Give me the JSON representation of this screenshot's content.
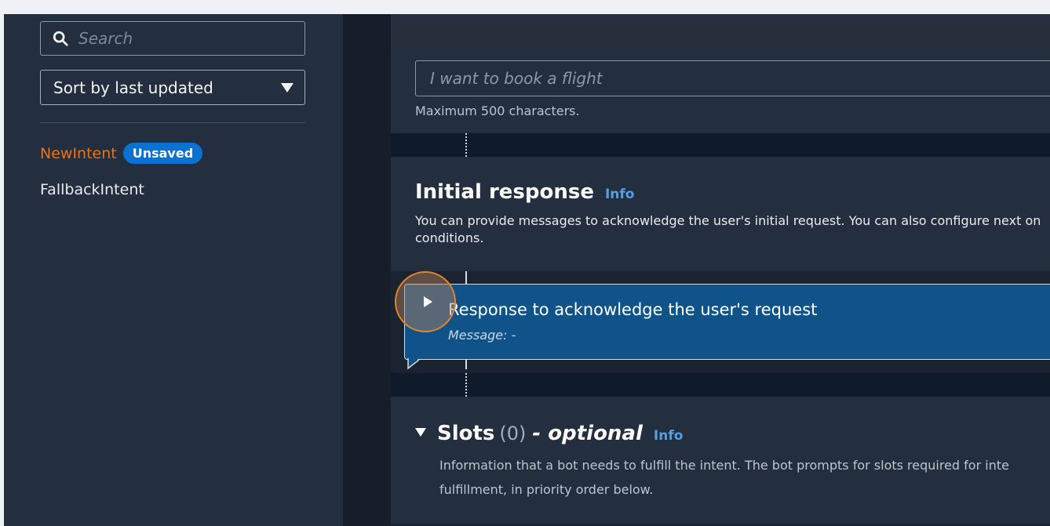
{
  "sidebar": {
    "search_placeholder": "Search",
    "sort_label": "Sort by last updated",
    "intents": [
      {
        "name": "NewIntent",
        "badge": "Unsaved"
      },
      {
        "name": "FallbackIntent"
      }
    ]
  },
  "utterance": {
    "placeholder": "I want to book a flight",
    "helper": "Maximum 500 characters."
  },
  "initial_response": {
    "title": "Initial response",
    "info": "Info",
    "description": "You can provide messages to acknowledge the user's initial request. You can also configure next on conditions.",
    "card_title": "Response to acknowledge the user's request",
    "card_message": "Message: -"
  },
  "slots": {
    "title": "Slots",
    "count": "(0)",
    "optional": "- optional",
    "info": "Info",
    "description": "Information that a bot needs to fulfill the intent. The bot prompts for slots required for inte fulfillment, in priority order below."
  },
  "colors": {
    "accent_orange": "#ec7211",
    "badge_blue": "#0972d3",
    "info_link": "#539fe5",
    "card_blue": "#0f5389"
  }
}
